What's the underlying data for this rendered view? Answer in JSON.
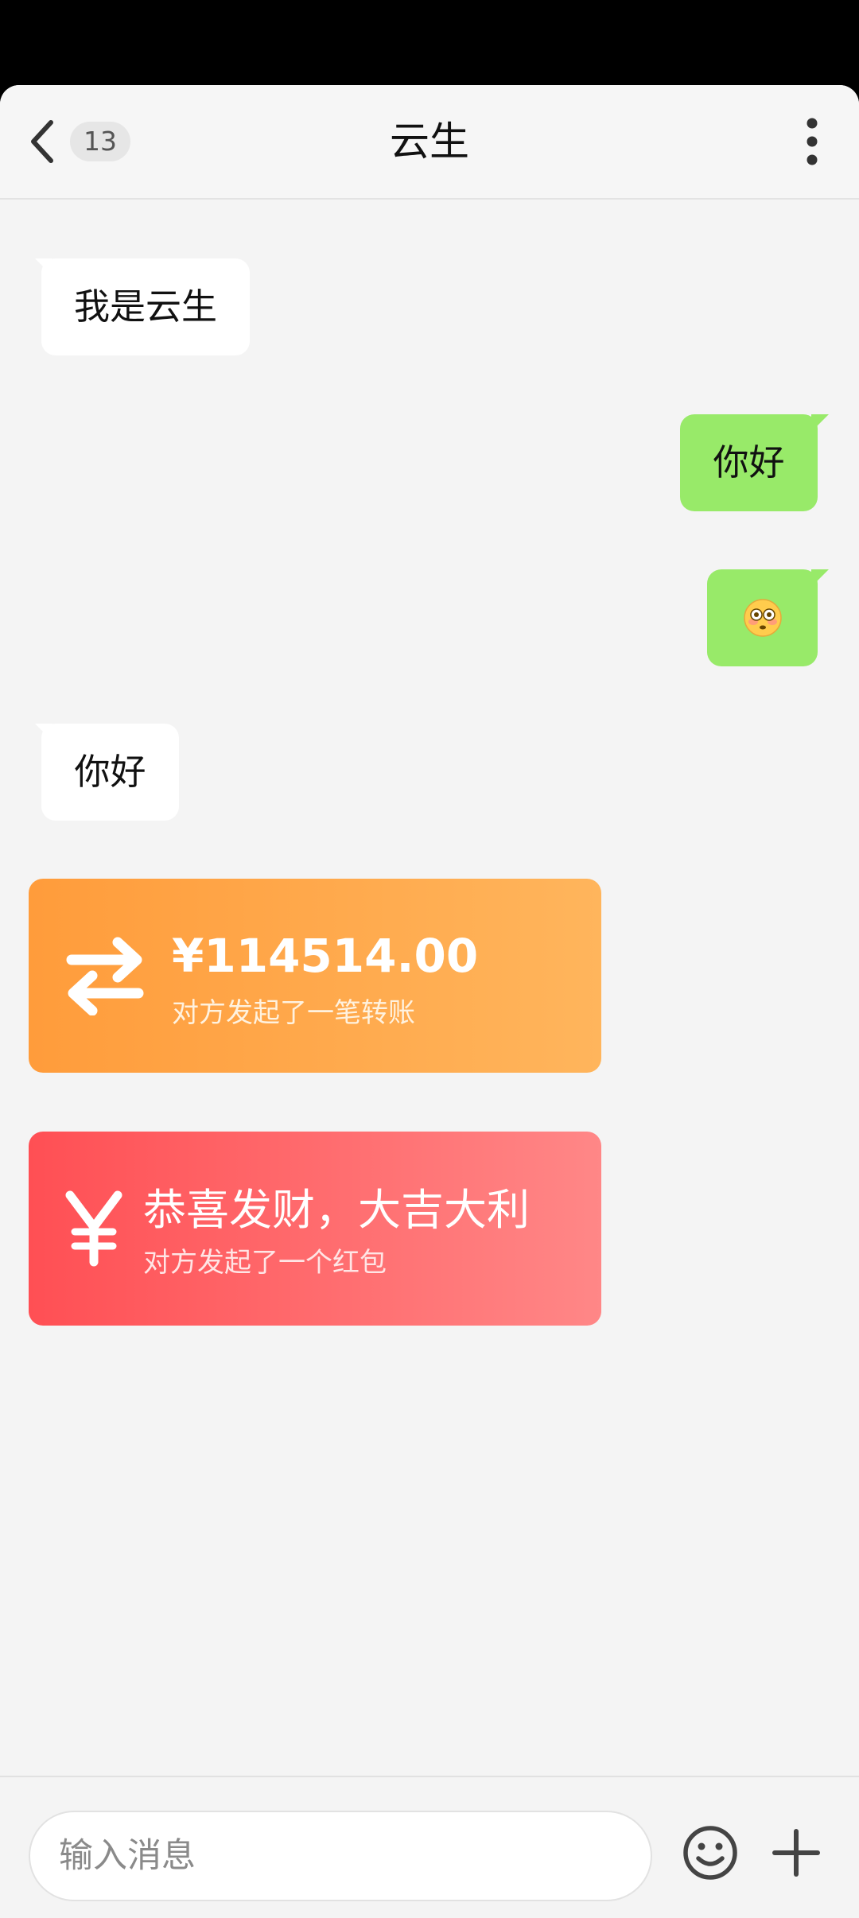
{
  "header": {
    "title": "云生",
    "unread_count": "13",
    "back_icon": "chevron-left-icon",
    "more_icon": "more-vertical-icon"
  },
  "messages": [
    {
      "side": "left",
      "text": "我是云生"
    },
    {
      "side": "right",
      "text": "你好"
    },
    {
      "side": "right",
      "emoji": "flushed-face-emoji"
    },
    {
      "side": "left",
      "text": "你好"
    }
  ],
  "transfer_card": {
    "amount": "¥114514.00",
    "subtitle": "对方发起了一笔转账",
    "icon": "transfer-arrows-icon",
    "colors": [
      "#ff9c3b",
      "#ffb55c"
    ]
  },
  "red_packet_card": {
    "title": "恭喜发财，大吉大利",
    "subtitle": "对方发起了一个红包",
    "icon": "yen-icon",
    "colors": [
      "#ff4f54",
      "#ff8787"
    ]
  },
  "input_bar": {
    "placeholder": "输入消息",
    "value": "",
    "emoji_icon": "smiley-icon",
    "plus_icon": "plus-icon"
  },
  "colors": {
    "outgoing_bubble": "#98ea69",
    "incoming_bubble": "#ffffff",
    "background": "#f4f4f4"
  }
}
